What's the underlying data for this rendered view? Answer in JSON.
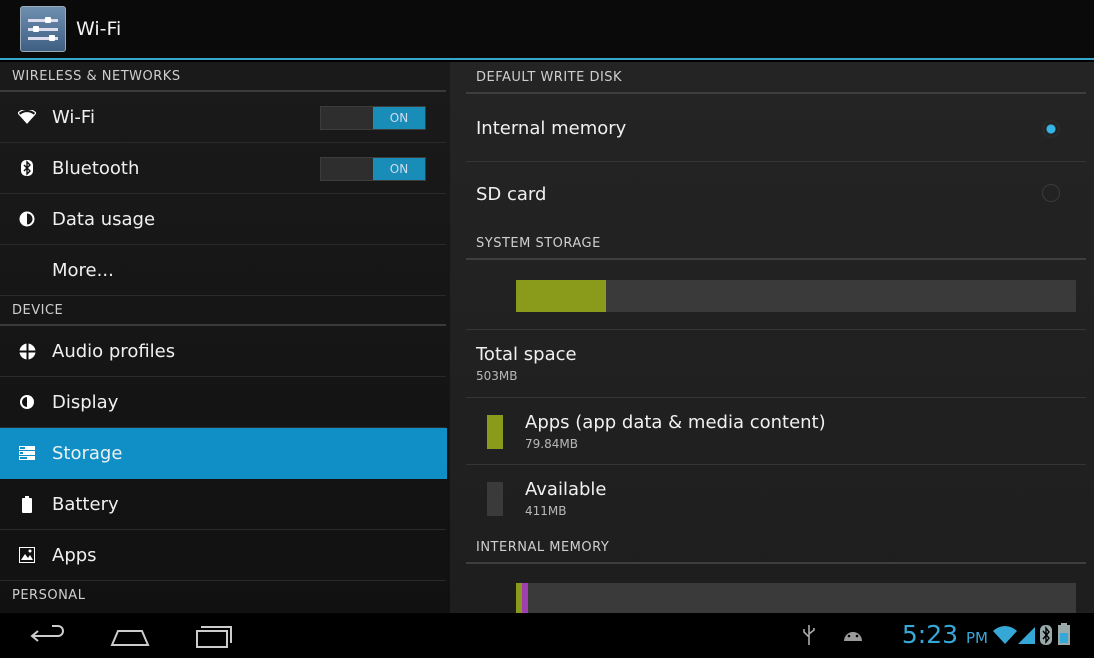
{
  "actionbar": {
    "title": "Wi-Fi",
    "icon": "settings-sliders-icon"
  },
  "left": {
    "sections": {
      "wireless": "WIRELESS & NETWORKS",
      "device": "DEVICE",
      "personal": "PERSONAL"
    },
    "items": {
      "wifi": {
        "label": "Wi-Fi",
        "icon": "wifi-icon",
        "toggle": "ON"
      },
      "bluetooth": {
        "label": "Bluetooth",
        "icon": "bluetooth-icon",
        "toggle": "ON"
      },
      "data_usage": {
        "label": "Data usage",
        "icon": "data-usage-icon"
      },
      "more": {
        "label": "More..."
      },
      "audio_profiles": {
        "label": "Audio profiles",
        "icon": "audio-profiles-icon"
      },
      "display": {
        "label": "Display",
        "icon": "display-icon"
      },
      "storage": {
        "label": "Storage",
        "icon": "storage-icon"
      },
      "battery": {
        "label": "Battery",
        "icon": "battery-icon"
      },
      "apps": {
        "label": "Apps",
        "icon": "apps-icon"
      }
    }
  },
  "right": {
    "default_write_disk": {
      "header": "DEFAULT WRITE DISK",
      "options": [
        {
          "label": "Internal memory",
          "checked": true
        },
        {
          "label": "SD card",
          "checked": false
        }
      ]
    },
    "system_storage": {
      "header": "SYSTEM STORAGE",
      "used_fraction": 0.16,
      "total_label": "Total space",
      "total_value": "503MB",
      "apps_label": "Apps (app data & media content)",
      "apps_value": "79.84MB",
      "available_label": "Available",
      "available_value": "411MB"
    },
    "internal_memory": {
      "header": "INTERNAL MEMORY"
    }
  },
  "colors": {
    "accent": "#33b5e5",
    "selected": "#0f8fc5",
    "apps_swatch": "#8a9a1a",
    "available_swatch": "#3a3a3a"
  },
  "statusbar": {
    "time": "5:23",
    "ampm": "PM",
    "icons": [
      "usb-icon",
      "android-debug-icon",
      "wifi-signal-icon",
      "cell-signal-icon",
      "bluetooth-status-icon",
      "battery-status-icon"
    ]
  },
  "navbar": {
    "buttons": [
      "back-icon",
      "home-icon",
      "recent-apps-icon"
    ]
  }
}
